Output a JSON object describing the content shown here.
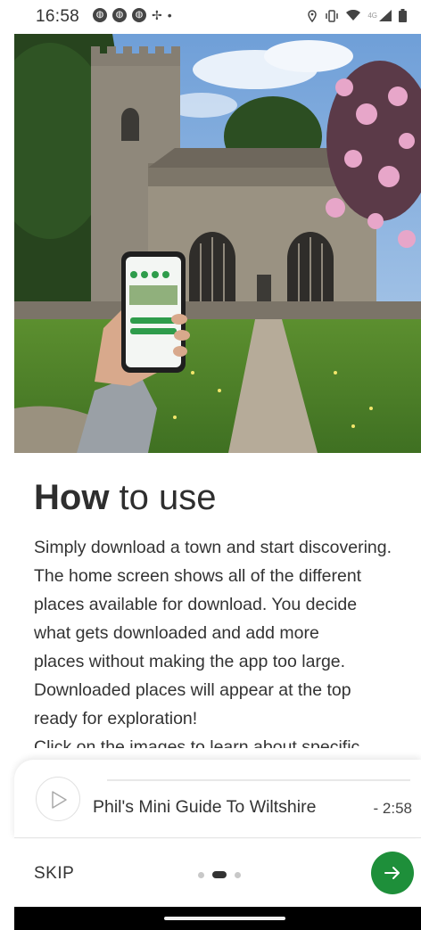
{
  "status_bar": {
    "time": "16:58",
    "left_icons": [
      "notification-icon",
      "notification-icon",
      "notification-icon",
      "fan-icon",
      "dot-icon"
    ],
    "right_icons": [
      "location-icon",
      "vibrate-icon",
      "wifi-icon",
      "signal-icon",
      "battery-icon"
    ],
    "network_label": "4G"
  },
  "hero": {
    "image_semantic": "church-photo-with-hand-holding-phone"
  },
  "intro": {
    "heading_bold": "How",
    "heading_rest": " to use",
    "lines": [
      "Simply download a town and start discovering.",
      "The home screen shows all of the different",
      "places available for download. You decide",
      "what gets downloaded and add more",
      "places without making the app too large.",
      "Downloaded places will appear at the top",
      "ready for exploration!",
      "Click on the images to learn about specific"
    ]
  },
  "player": {
    "title": "Phil's Mini Guide To Wiltshire",
    "time_remaining": "- 2:58",
    "progress": 0
  },
  "footer": {
    "skip_label": "SKIP",
    "page_count": 3,
    "active_page": 2
  },
  "colors": {
    "accent_green": "#1e8f3a",
    "text": "#333333"
  }
}
